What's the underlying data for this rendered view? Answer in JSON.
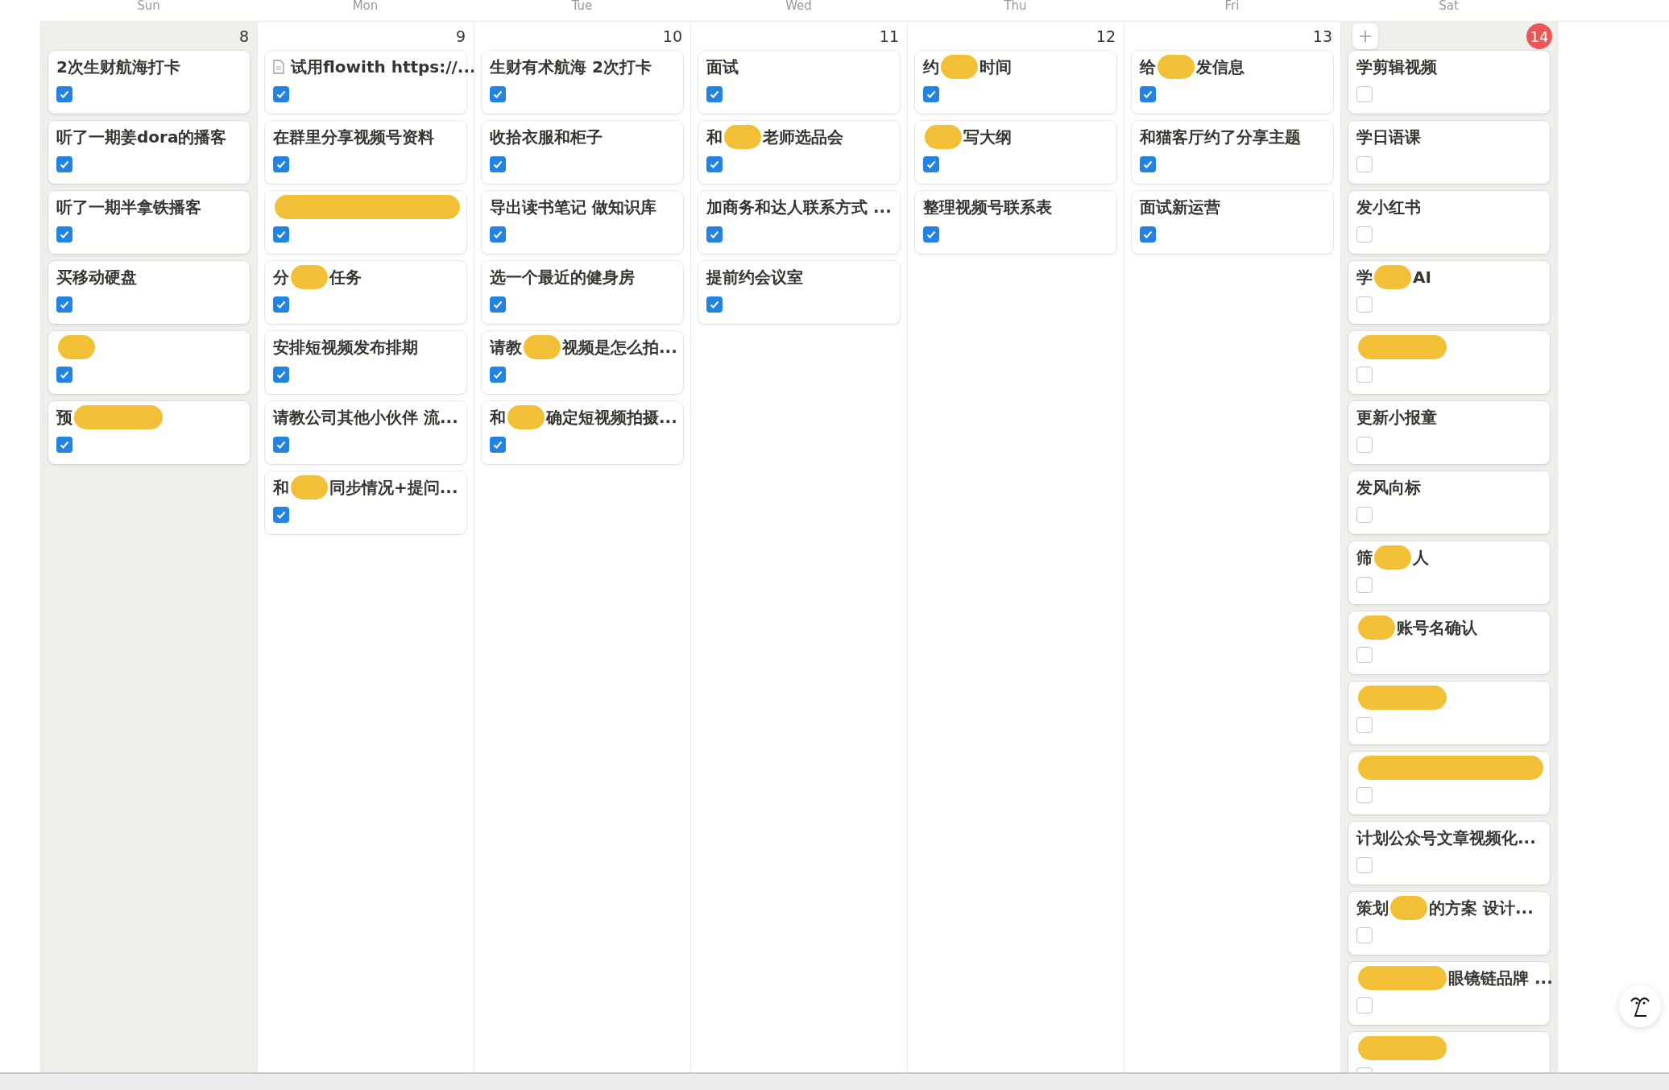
{
  "weekdays": [
    "Sun",
    "Mon",
    "Tue",
    "Wed",
    "Thu",
    "Fri",
    "Sat"
  ],
  "days": [
    {
      "number": "8",
      "today": false,
      "weekend": true,
      "add_button": false,
      "cards": [
        {
          "segments": [
            {
              "kind": "text",
              "text": "2次生财航海打卡"
            }
          ],
          "checked": true
        },
        {
          "segments": [
            {
              "kind": "text",
              "text": "听了一期姜dora的播客"
            }
          ],
          "checked": true
        },
        {
          "segments": [
            {
              "kind": "text",
              "text": "听了一期半拿铁播客"
            }
          ],
          "checked": true
        },
        {
          "segments": [
            {
              "kind": "text",
              "text": "买移动硬盘"
            }
          ],
          "checked": true
        },
        {
          "segments": [
            {
              "kind": "redaction"
            }
          ],
          "checked": true
        },
        {
          "segments": [
            {
              "kind": "text",
              "text": "预"
            },
            {
              "kind": "long_redaction"
            }
          ],
          "checked": true
        }
      ]
    },
    {
      "number": "9",
      "today": false,
      "weekend": false,
      "add_button": false,
      "cards": [
        {
          "kind": "page",
          "segments": [
            {
              "kind": "text",
              "text": "试用flowith https://..."
            }
          ],
          "checked": true
        },
        {
          "segments": [
            {
              "kind": "text",
              "text": "在群里分享视频号资料"
            }
          ],
          "checked": true
        },
        {
          "segments": [
            {
              "kind": "full_redaction"
            }
          ],
          "checked": true
        },
        {
          "segments": [
            {
              "kind": "text",
              "text": "分"
            },
            {
              "kind": "redaction"
            },
            {
              "kind": "text",
              "text": "任务"
            }
          ],
          "checked": true
        },
        {
          "segments": [
            {
              "kind": "text",
              "text": "安排短视频发布排期"
            }
          ],
          "checked": true
        },
        {
          "segments": [
            {
              "kind": "text",
              "text": "请教公司其他小伙伴 流..."
            }
          ],
          "checked": true
        },
        {
          "segments": [
            {
              "kind": "text",
              "text": "和"
            },
            {
              "kind": "redaction"
            },
            {
              "kind": "text",
              "text": "同步情况+提问..."
            }
          ],
          "checked": true
        }
      ]
    },
    {
      "number": "10",
      "today": false,
      "weekend": false,
      "add_button": false,
      "cards": [
        {
          "segments": [
            {
              "kind": "text",
              "text": "生财有术航海 2次打卡"
            }
          ],
          "checked": true
        },
        {
          "segments": [
            {
              "kind": "text",
              "text": "收拾衣服和柜子"
            }
          ],
          "checked": true
        },
        {
          "segments": [
            {
              "kind": "text",
              "text": "导出读书笔记 做知识库"
            }
          ],
          "checked": true
        },
        {
          "segments": [
            {
              "kind": "text",
              "text": "选一个最近的健身房"
            }
          ],
          "checked": true
        },
        {
          "segments": [
            {
              "kind": "text",
              "text": "请教"
            },
            {
              "kind": "redaction"
            },
            {
              "kind": "text",
              "text": "视频是怎么拍..."
            }
          ],
          "checked": true
        },
        {
          "segments": [
            {
              "kind": "text",
              "text": "和"
            },
            {
              "kind": "redaction"
            },
            {
              "kind": "text",
              "text": "确定短视频拍摄..."
            }
          ],
          "checked": true
        }
      ]
    },
    {
      "number": "11",
      "today": false,
      "weekend": false,
      "add_button": false,
      "cards": [
        {
          "segments": [
            {
              "kind": "text",
              "text": "面试"
            }
          ],
          "checked": true
        },
        {
          "segments": [
            {
              "kind": "text",
              "text": "和"
            },
            {
              "kind": "redaction"
            },
            {
              "kind": "text",
              "text": "老师选品会"
            }
          ],
          "checked": true
        },
        {
          "segments": [
            {
              "kind": "text",
              "text": "加商务和达人联系方式 ..."
            }
          ],
          "checked": true
        },
        {
          "segments": [
            {
              "kind": "text",
              "text": "提前约会议室"
            }
          ],
          "checked": true
        }
      ]
    },
    {
      "number": "12",
      "today": false,
      "weekend": false,
      "add_button": false,
      "cards": [
        {
          "segments": [
            {
              "kind": "text",
              "text": "约"
            },
            {
              "kind": "redaction"
            },
            {
              "kind": "text",
              "text": "时间"
            }
          ],
          "checked": true
        },
        {
          "segments": [
            {
              "kind": "redaction"
            },
            {
              "kind": "text",
              "text": "写大纲"
            }
          ],
          "checked": true
        },
        {
          "segments": [
            {
              "kind": "text",
              "text": "整理视频号联系表"
            }
          ],
          "checked": true
        }
      ]
    },
    {
      "number": "13",
      "today": false,
      "weekend": false,
      "add_button": false,
      "cards": [
        {
          "segments": [
            {
              "kind": "text",
              "text": "给"
            },
            {
              "kind": "redaction"
            },
            {
              "kind": "text",
              "text": "发信息"
            }
          ],
          "checked": true
        },
        {
          "segments": [
            {
              "kind": "text",
              "text": "和猫客厅约了分享主题"
            }
          ],
          "checked": true
        },
        {
          "segments": [
            {
              "kind": "text",
              "text": "面试新运营"
            }
          ],
          "checked": true
        }
      ]
    },
    {
      "number": "14",
      "today": true,
      "weekend": true,
      "add_button": true,
      "cards": [
        {
          "segments": [
            {
              "kind": "text",
              "text": "学剪辑视频"
            }
          ],
          "checked": false
        },
        {
          "segments": [
            {
              "kind": "text",
              "text": "学日语课"
            }
          ],
          "checked": false
        },
        {
          "segments": [
            {
              "kind": "text",
              "text": "发小红书"
            }
          ],
          "checked": false
        },
        {
          "segments": [
            {
              "kind": "text",
              "text": "学"
            },
            {
              "kind": "redaction"
            },
            {
              "kind": "text",
              "text": "AI"
            }
          ],
          "checked": false
        },
        {
          "segments": [
            {
              "kind": "long_redaction"
            }
          ],
          "checked": false
        },
        {
          "segments": [
            {
              "kind": "text",
              "text": "更新小报童"
            }
          ],
          "checked": false
        },
        {
          "segments": [
            {
              "kind": "text",
              "text": "发风向标"
            }
          ],
          "checked": false
        },
        {
          "segments": [
            {
              "kind": "text",
              "text": "筛"
            },
            {
              "kind": "redaction"
            },
            {
              "kind": "text",
              "text": "人"
            }
          ],
          "checked": false
        },
        {
          "segments": [
            {
              "kind": "redaction"
            },
            {
              "kind": "text",
              "text": "账号名确认"
            }
          ],
          "checked": false
        },
        {
          "segments": [
            {
              "kind": "long_redaction"
            }
          ],
          "checked": false
        },
        {
          "segments": [
            {
              "kind": "full_redaction"
            }
          ],
          "checked": false
        },
        {
          "segments": [
            {
              "kind": "text",
              "text": "计划公众号文章视频化..."
            }
          ],
          "checked": false
        },
        {
          "segments": [
            {
              "kind": "text",
              "text": "策划"
            },
            {
              "kind": "redaction"
            },
            {
              "kind": "text",
              "text": "的方案 设计..."
            }
          ],
          "checked": false
        },
        {
          "segments": [
            {
              "kind": "long_redaction"
            },
            {
              "kind": "text",
              "text": "眼镜链品牌 ..."
            }
          ],
          "checked": false
        },
        {
          "segments": [
            {
              "kind": "long_redaction"
            }
          ],
          "checked": false
        }
      ]
    }
  ]
}
